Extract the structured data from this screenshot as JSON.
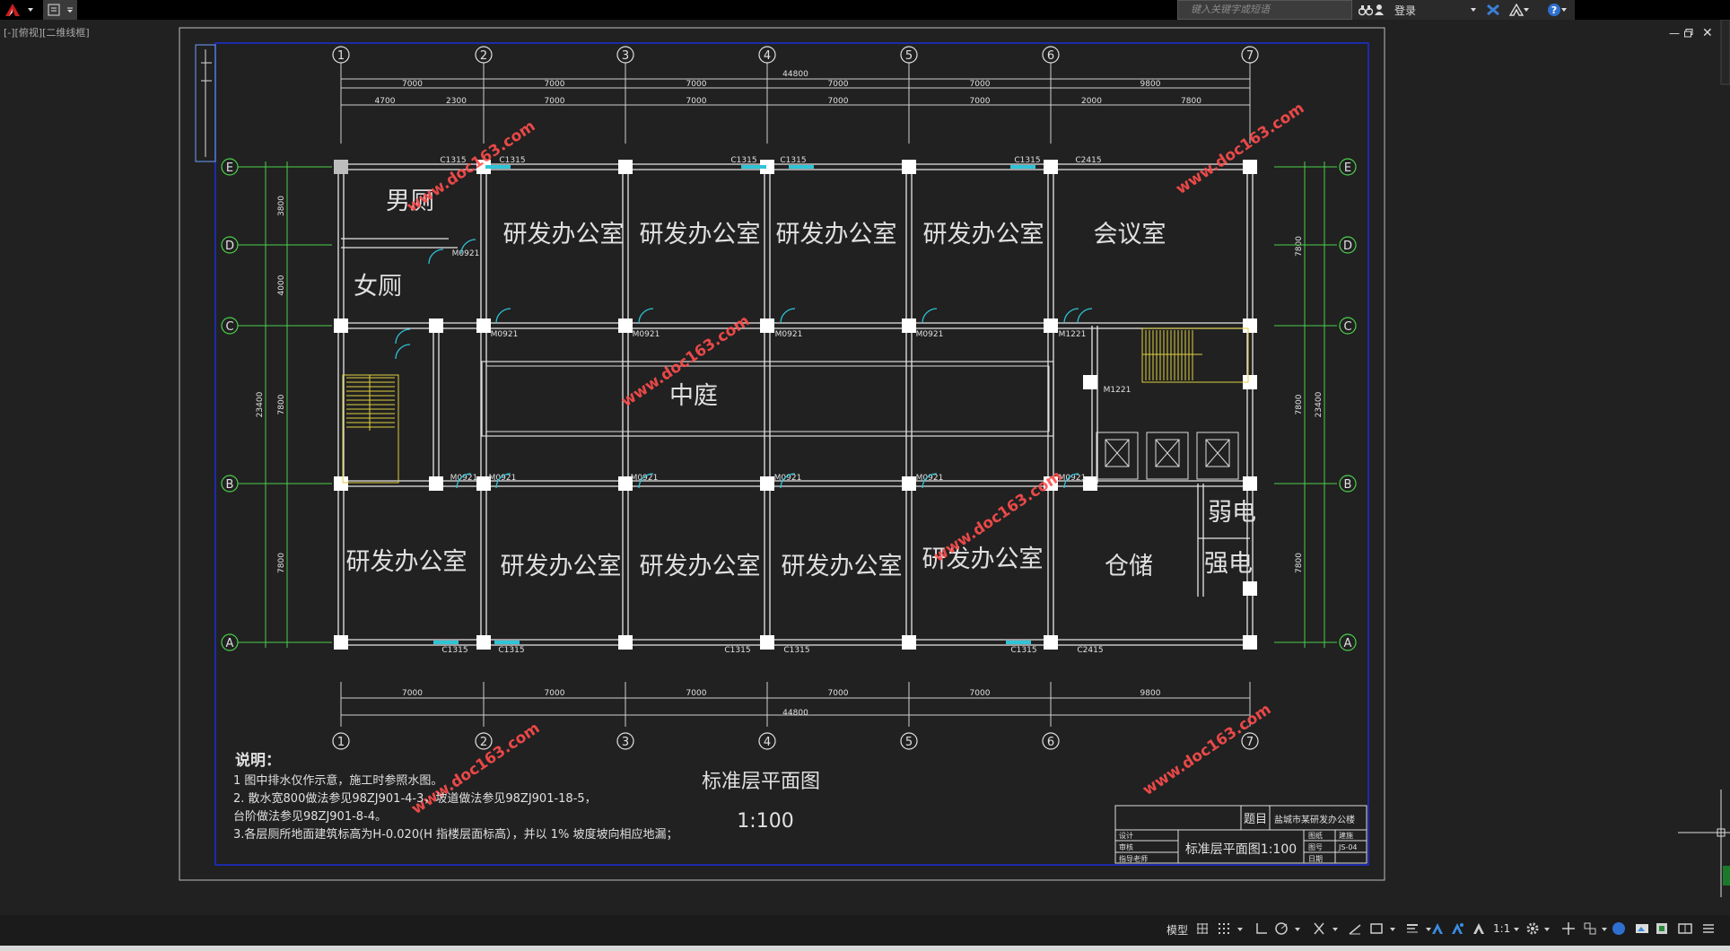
{
  "app": {
    "search_placeholder": "键入关键字或短语",
    "login_label": "登录",
    "view_label": "[-][俯视][二维线框]"
  },
  "drawing": {
    "grid_cols": [
      "1",
      "2",
      "3",
      "4",
      "5",
      "6",
      "7"
    ],
    "grid_rows": [
      "E",
      "D",
      "C",
      "B",
      "A"
    ],
    "top_dims_row1": [
      "7000",
      "7000",
      "7000",
      "7000",
      "7000",
      "9800"
    ],
    "top_dims_row1_total": "44800",
    "top_dims_row2": [
      "4700",
      "2300",
      "7000",
      "7000",
      "7000",
      "7000",
      "2000",
      "7800"
    ],
    "bottom_dims": [
      "7000",
      "7000",
      "7000",
      "7000",
      "7000",
      "9800"
    ],
    "bottom_dims_total": "44800",
    "left_dims_inner": [
      "3800",
      "4000",
      "7800",
      "7800"
    ],
    "left_dims_total": "23400",
    "right_dims_inner": [
      "7800",
      "7800",
      "7800"
    ],
    "right_dims_total": "23400",
    "rooms": {
      "male_toilet": "男厕",
      "female_toilet": "女厕",
      "office": "研发办公室",
      "meeting": "会议室",
      "courtyard": "中庭",
      "storage": "仓储",
      "weak_elec": "弱电",
      "strong_elec": "强电"
    },
    "windows": {
      "c1315": "C1315",
      "c2415": "C2415"
    },
    "doors": {
      "m0921": "M0921",
      "m1221": "M1221"
    },
    "watermark": "www.doc163.com",
    "title": "标准层平面图",
    "scale": "1:100",
    "notes_title": "说明：",
    "notes": [
      "1 图中排水仅作示意，施工时参照水图。",
      "2. 散水宽800做法参见98ZJ901-4-3，坡道做法参见98ZJ901-18-5，",
      "   台阶做法参见98ZJ901-8-4。",
      "3.各层厕所地面建筑标高为H-0.020(H 指楼层面标高），并以 1% 坡度坡向相应地漏；"
    ],
    "titleblock": {
      "label_title": "题目",
      "project": "盐城市某研发办公楼",
      "drawing_name": "标准层平面图1:100",
      "col1": [
        "设计",
        "审核",
        "指导老师"
      ],
      "col2": [
        "图纸",
        "图号",
        "日期"
      ],
      "col3": [
        "建施",
        "JS-04",
        ""
      ]
    }
  },
  "statusbar": {
    "model_label": "模型",
    "scale_label": "1:1"
  }
}
